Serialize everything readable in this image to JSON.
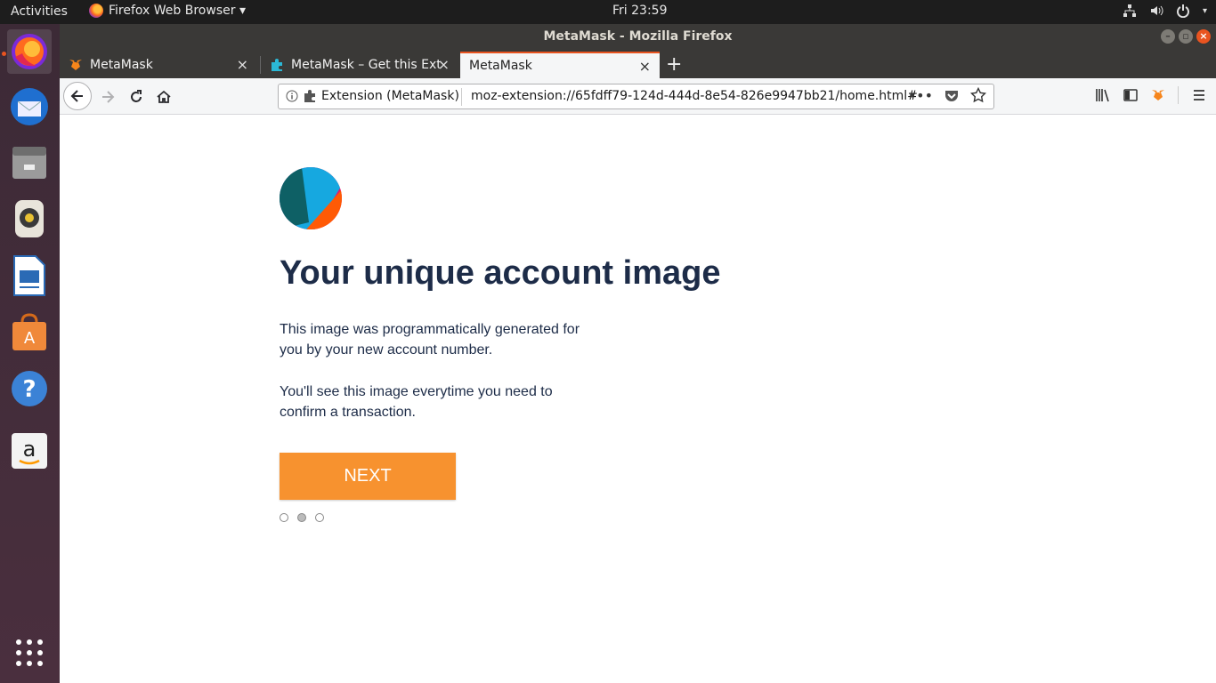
{
  "system": {
    "activities": "Activities",
    "app_menu": "Firefox Web Browser ▾",
    "clock": "Fri 23:59"
  },
  "window": {
    "title": "MetaMask - Mozilla Firefox"
  },
  "tabs": [
    {
      "label": "MetaMask",
      "close": "×"
    },
    {
      "label": "MetaMask – Get this Ext",
      "close": "×"
    },
    {
      "label": "MetaMask",
      "close": "×"
    }
  ],
  "new_tab": "+",
  "urlbar": {
    "identity": "Extension (MetaMask)",
    "url": "moz-extension://65fdff79-124d-444d-8e54-826e9947bb21/home.html#",
    "more": "•••"
  },
  "content": {
    "headline": "Your unique account image",
    "paragraph1": "This image was programmatically generated for you by your new account number.",
    "paragraph2": "You'll see this image everytime you need to confirm a transaction.",
    "next_button": "NEXT",
    "progress": {
      "current_step": 2,
      "total_steps": 3
    }
  },
  "colors": {
    "accent": "#f7922f",
    "heading": "#1d2c48",
    "ubuntu_orange": "#e95420"
  },
  "dock": {
    "items": [
      "firefox-icon",
      "thunderbird-icon",
      "files-icon",
      "rhythmbox-icon",
      "libreoffice-writer-icon",
      "software-center-icon",
      "help-icon",
      "amazon-icon",
      "show-apps-icon"
    ]
  }
}
